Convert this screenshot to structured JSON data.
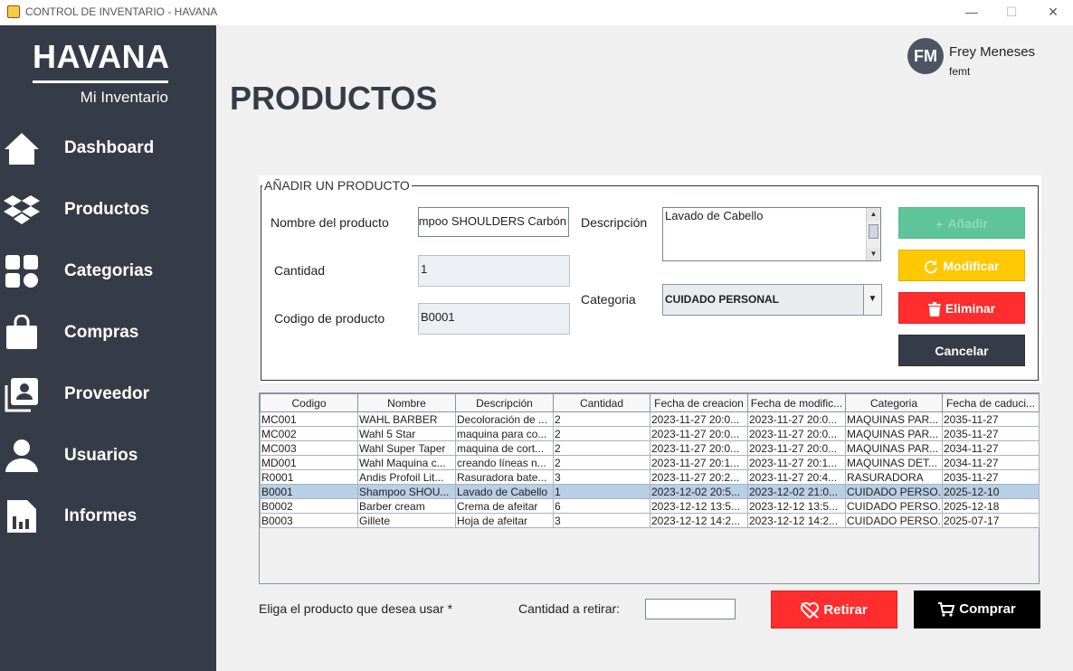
{
  "window": {
    "title": "CONTROL DE INVENTARIO - HAVANA",
    "controls": [
      "—",
      "☐",
      "✕"
    ]
  },
  "sidebar": {
    "brand": "HAVANA",
    "subtitle": "Mi Inventario",
    "items": [
      {
        "label": "Dashboard",
        "icon": "home-icon"
      },
      {
        "label": "Productos",
        "icon": "dropbox-icon"
      },
      {
        "label": "Categorias",
        "icon": "grid-icon"
      },
      {
        "label": "Compras",
        "icon": "shopping-bag-icon"
      },
      {
        "label": "Proveedor",
        "icon": "contact-card-icon"
      },
      {
        "label": "Usuarios",
        "icon": "user-icon"
      },
      {
        "label": "Informes",
        "icon": "report-icon"
      }
    ]
  },
  "user": {
    "initials": "FM",
    "name": "Frey Meneses",
    "login": "femt"
  },
  "page": {
    "title": "PRODUCTOS"
  },
  "form": {
    "legend": "AÑADIR UN PRODUCTO",
    "name_label": "Nombre del producto",
    "name_value": "Shampoo SHOULDERS Carbón",
    "quantity_label": "Cantidad",
    "quantity_value": "1",
    "code_label": "Codigo de producto",
    "code_value": "B0001",
    "description_label": "Descripción",
    "description_value": "Lavado de Cabello",
    "category_label": "Categoria",
    "category_value": "CUIDADO PERSONAL",
    "buttons": {
      "add": "Añadir",
      "modify": "Modificar",
      "delete": "Eliminar",
      "cancel": "Cancelar"
    }
  },
  "table": {
    "columns": [
      "Codigo",
      "Nombre",
      "Descripción",
      "Cantidad",
      "Fecha de creacion",
      "Fecha de modific...",
      "Categoria",
      "Fecha de caduci..."
    ],
    "selected_row": 5,
    "rows": [
      [
        "MC001",
        "WAHL BARBER",
        "Decoloración de ...",
        "2",
        "2023-11-27 20:0...",
        "2023-11-27 20:0...",
        "MAQUINAS PAR...",
        "2035-11-27"
      ],
      [
        "MC002",
        "Wahl 5 Star",
        "maquina para co...",
        "2",
        "2023-11-27 20:0...",
        "2023-11-27 20:0...",
        "MAQUINAS PAR...",
        "2035-11-27"
      ],
      [
        "MC003",
        "Wahl Super Taper",
        "maquina de cort...",
        "2",
        "2023-11-27 20:0...",
        "2023-11-27 20:0...",
        "MAQUINAS PAR...",
        "2034-11-27"
      ],
      [
        "MD001",
        "Wahl Maquina c...",
        "creando líneas n...",
        "2",
        "2023-11-27 20:1...",
        "2023-11-27 20:1...",
        "MAQUINAS DET...",
        "2034-11-27"
      ],
      [
        "R0001",
        "Andis Profoil Lit...",
        "Rasuradora bate...",
        "3",
        "2023-11-27 20:2...",
        "2023-11-27 20:4...",
        "RASURADORA",
        "2035-11-27"
      ],
      [
        "B0001",
        "Shampoo SHOU...",
        "Lavado de Cabello",
        "1",
        "2023-12-02 20:5...",
        "2023-12-02 21:0...",
        "CUIDADO PERSO...",
        "2025-12-10"
      ],
      [
        "B0002",
        "Barber cream",
        "Crema de afeitar",
        "6",
        "2023-12-12 13:5...",
        "2023-12-12 13:5...",
        "CUIDADO PERSO...",
        "2025-12-18"
      ],
      [
        "B0003",
        "Gillete",
        "Hoja de afeitar",
        "3",
        "2023-12-12 14:2...",
        "2023-12-12 14:2...",
        "CUIDADO PERSO...",
        "2025-07-17"
      ]
    ]
  },
  "footer": {
    "prompt": "Eliga el producto que desea usar *",
    "qty_label": "Cantidad a retirar:",
    "qty_value": "",
    "retirar": "Retirar",
    "comprar": "Comprar"
  },
  "colors": {
    "sidebar": "#353c47",
    "add": "#5ec49a",
    "modify": "#ffc800",
    "delete": "#ff2d2d",
    "selected_row": "#b8cfe5"
  }
}
